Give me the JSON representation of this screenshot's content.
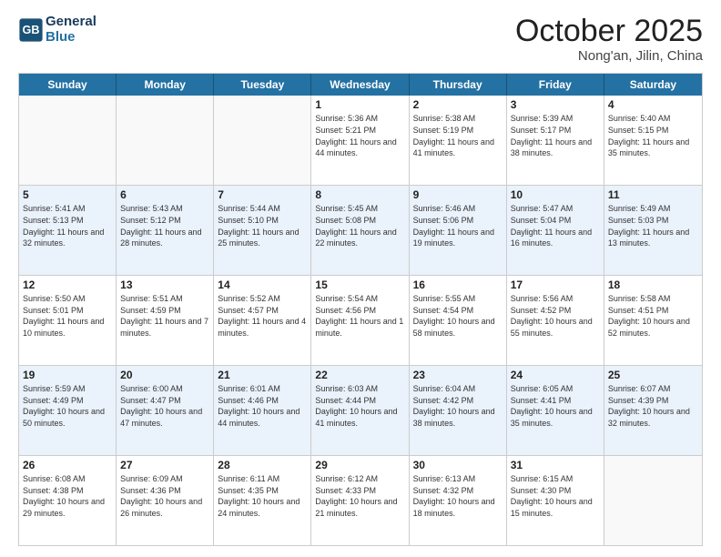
{
  "header": {
    "logo_line1": "General",
    "logo_line2": "Blue",
    "month_title": "October 2025",
    "location": "Nong'an, Jilin, China"
  },
  "days_of_week": [
    "Sunday",
    "Monday",
    "Tuesday",
    "Wednesday",
    "Thursday",
    "Friday",
    "Saturday"
  ],
  "rows": [
    [
      {
        "day": "",
        "sunrise": "",
        "sunset": "",
        "daylight": ""
      },
      {
        "day": "",
        "sunrise": "",
        "sunset": "",
        "daylight": ""
      },
      {
        "day": "",
        "sunrise": "",
        "sunset": "",
        "daylight": ""
      },
      {
        "day": "1",
        "sunrise": "Sunrise: 5:36 AM",
        "sunset": "Sunset: 5:21 PM",
        "daylight": "Daylight: 11 hours and 44 minutes."
      },
      {
        "day": "2",
        "sunrise": "Sunrise: 5:38 AM",
        "sunset": "Sunset: 5:19 PM",
        "daylight": "Daylight: 11 hours and 41 minutes."
      },
      {
        "day": "3",
        "sunrise": "Sunrise: 5:39 AM",
        "sunset": "Sunset: 5:17 PM",
        "daylight": "Daylight: 11 hours and 38 minutes."
      },
      {
        "day": "4",
        "sunrise": "Sunrise: 5:40 AM",
        "sunset": "Sunset: 5:15 PM",
        "daylight": "Daylight: 11 hours and 35 minutes."
      }
    ],
    [
      {
        "day": "5",
        "sunrise": "Sunrise: 5:41 AM",
        "sunset": "Sunset: 5:13 PM",
        "daylight": "Daylight: 11 hours and 32 minutes."
      },
      {
        "day": "6",
        "sunrise": "Sunrise: 5:43 AM",
        "sunset": "Sunset: 5:12 PM",
        "daylight": "Daylight: 11 hours and 28 minutes."
      },
      {
        "day": "7",
        "sunrise": "Sunrise: 5:44 AM",
        "sunset": "Sunset: 5:10 PM",
        "daylight": "Daylight: 11 hours and 25 minutes."
      },
      {
        "day": "8",
        "sunrise": "Sunrise: 5:45 AM",
        "sunset": "Sunset: 5:08 PM",
        "daylight": "Daylight: 11 hours and 22 minutes."
      },
      {
        "day": "9",
        "sunrise": "Sunrise: 5:46 AM",
        "sunset": "Sunset: 5:06 PM",
        "daylight": "Daylight: 11 hours and 19 minutes."
      },
      {
        "day": "10",
        "sunrise": "Sunrise: 5:47 AM",
        "sunset": "Sunset: 5:04 PM",
        "daylight": "Daylight: 11 hours and 16 minutes."
      },
      {
        "day": "11",
        "sunrise": "Sunrise: 5:49 AM",
        "sunset": "Sunset: 5:03 PM",
        "daylight": "Daylight: 11 hours and 13 minutes."
      }
    ],
    [
      {
        "day": "12",
        "sunrise": "Sunrise: 5:50 AM",
        "sunset": "Sunset: 5:01 PM",
        "daylight": "Daylight: 11 hours and 10 minutes."
      },
      {
        "day": "13",
        "sunrise": "Sunrise: 5:51 AM",
        "sunset": "Sunset: 4:59 PM",
        "daylight": "Daylight: 11 hours and 7 minutes."
      },
      {
        "day": "14",
        "sunrise": "Sunrise: 5:52 AM",
        "sunset": "Sunset: 4:57 PM",
        "daylight": "Daylight: 11 hours and 4 minutes."
      },
      {
        "day": "15",
        "sunrise": "Sunrise: 5:54 AM",
        "sunset": "Sunset: 4:56 PM",
        "daylight": "Daylight: 11 hours and 1 minute."
      },
      {
        "day": "16",
        "sunrise": "Sunrise: 5:55 AM",
        "sunset": "Sunset: 4:54 PM",
        "daylight": "Daylight: 10 hours and 58 minutes."
      },
      {
        "day": "17",
        "sunrise": "Sunrise: 5:56 AM",
        "sunset": "Sunset: 4:52 PM",
        "daylight": "Daylight: 10 hours and 55 minutes."
      },
      {
        "day": "18",
        "sunrise": "Sunrise: 5:58 AM",
        "sunset": "Sunset: 4:51 PM",
        "daylight": "Daylight: 10 hours and 52 minutes."
      }
    ],
    [
      {
        "day": "19",
        "sunrise": "Sunrise: 5:59 AM",
        "sunset": "Sunset: 4:49 PM",
        "daylight": "Daylight: 10 hours and 50 minutes."
      },
      {
        "day": "20",
        "sunrise": "Sunrise: 6:00 AM",
        "sunset": "Sunset: 4:47 PM",
        "daylight": "Daylight: 10 hours and 47 minutes."
      },
      {
        "day": "21",
        "sunrise": "Sunrise: 6:01 AM",
        "sunset": "Sunset: 4:46 PM",
        "daylight": "Daylight: 10 hours and 44 minutes."
      },
      {
        "day": "22",
        "sunrise": "Sunrise: 6:03 AM",
        "sunset": "Sunset: 4:44 PM",
        "daylight": "Daylight: 10 hours and 41 minutes."
      },
      {
        "day": "23",
        "sunrise": "Sunrise: 6:04 AM",
        "sunset": "Sunset: 4:42 PM",
        "daylight": "Daylight: 10 hours and 38 minutes."
      },
      {
        "day": "24",
        "sunrise": "Sunrise: 6:05 AM",
        "sunset": "Sunset: 4:41 PM",
        "daylight": "Daylight: 10 hours and 35 minutes."
      },
      {
        "day": "25",
        "sunrise": "Sunrise: 6:07 AM",
        "sunset": "Sunset: 4:39 PM",
        "daylight": "Daylight: 10 hours and 32 minutes."
      }
    ],
    [
      {
        "day": "26",
        "sunrise": "Sunrise: 6:08 AM",
        "sunset": "Sunset: 4:38 PM",
        "daylight": "Daylight: 10 hours and 29 minutes."
      },
      {
        "day": "27",
        "sunrise": "Sunrise: 6:09 AM",
        "sunset": "Sunset: 4:36 PM",
        "daylight": "Daylight: 10 hours and 26 minutes."
      },
      {
        "day": "28",
        "sunrise": "Sunrise: 6:11 AM",
        "sunset": "Sunset: 4:35 PM",
        "daylight": "Daylight: 10 hours and 24 minutes."
      },
      {
        "day": "29",
        "sunrise": "Sunrise: 6:12 AM",
        "sunset": "Sunset: 4:33 PM",
        "daylight": "Daylight: 10 hours and 21 minutes."
      },
      {
        "day": "30",
        "sunrise": "Sunrise: 6:13 AM",
        "sunset": "Sunset: 4:32 PM",
        "daylight": "Daylight: 10 hours and 18 minutes."
      },
      {
        "day": "31",
        "sunrise": "Sunrise: 6:15 AM",
        "sunset": "Sunset: 4:30 PM",
        "daylight": "Daylight: 10 hours and 15 minutes."
      },
      {
        "day": "",
        "sunrise": "",
        "sunset": "",
        "daylight": ""
      }
    ]
  ]
}
